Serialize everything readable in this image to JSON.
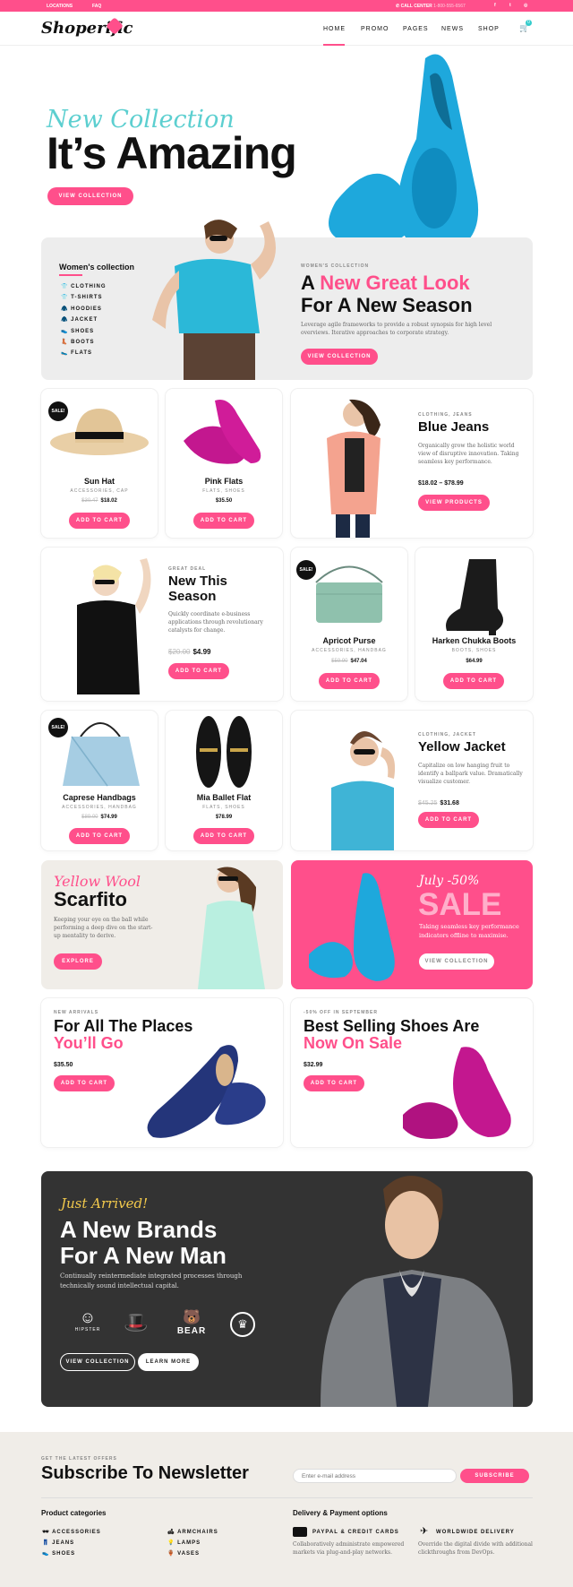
{
  "topbar": {
    "locations": "LOCATIONS",
    "faq": "FAQ",
    "call_center": "CALL CENTER",
    "phone": "1-800-555-6567"
  },
  "header": {
    "logo": "Shoperific",
    "nav": [
      "HOME",
      "PROMO",
      "PAGES",
      "NEWS",
      "SHOP"
    ],
    "cart_count": "0"
  },
  "hero": {
    "script": "New Collection",
    "title": "It’s Amazing",
    "button": "VIEW COLLECTION"
  },
  "women": {
    "heading": "Women's collection",
    "items": [
      "CLOTHING",
      "T-SHIRTS",
      "HOODIES",
      "JACKET",
      "SHOES",
      "BOOTS",
      "FLATS"
    ],
    "tag": "WOMEN'S COLLECTION",
    "title_a": "A ",
    "title_pink": "New Great Look",
    "title_b": "For A New Season",
    "text": "Leverage agile frameworks to provide a robust synopsis for high level overviews. Iterative approaches to corporate strategy.",
    "button": "VIEW COLLECTION"
  },
  "p_sunhat": {
    "sale": "SALE!",
    "name": "Sun Hat",
    "cat": "ACCESSORIES, CAP",
    "old": "$30.47",
    "price": "$18.02",
    "button": "ADD TO CART"
  },
  "p_pinkflats": {
    "name": "Pink Flats",
    "cat": "FLATS, SHOES",
    "price": "$35.50",
    "button": "ADD TO CART"
  },
  "jeans": {
    "tag": "CLOTHING, JEANS",
    "title": "Blue Jeans",
    "text": "Organically grow the holistic world view of disruptive innovation. Taking seamless key performance.",
    "price": "$18.02 – $78.99",
    "button": "VIEW PRODUCTS"
  },
  "season": {
    "tag": "GREAT DEAL",
    "title_1": "New This",
    "title_2": "Season",
    "text": "Quickly coordinate e-business applications through revolutionary catalysts for change.",
    "old": "$20.00",
    "price": "$4.99",
    "button": "ADD TO CART"
  },
  "p_purse": {
    "sale": "SALE!",
    "name": "Apricot Purse",
    "cat": "ACCESSORIES, HANDBAG",
    "old": "$59.90",
    "price": "$47.04",
    "button": "ADD TO CART"
  },
  "p_boots": {
    "name": "Harken Chukka Boots",
    "cat": "BOOTS, SHOES",
    "price": "$64.99",
    "button": "ADD TO CART"
  },
  "p_caprese": {
    "sale": "SALE!",
    "name": "Caprese Handbags",
    "cat": "ACCESSORIES, HANDBAG",
    "old": "$89.00",
    "price": "$74.99",
    "button": "ADD TO CART"
  },
  "p_ballet": {
    "name": "Mia Ballet Flat",
    "cat": "FLATS, SHOES",
    "price": "$78.99",
    "button": "ADD TO CART"
  },
  "jacket": {
    "tag": "CLOTHING, JACKET",
    "title": "Yellow Jacket",
    "text": "Capitalize on low hanging fruit to identify a ballpark value. Dramatically visualize customer.",
    "old": "$45.25",
    "price": "$31.68",
    "button": "ADD TO CART"
  },
  "scarf": {
    "script": "Yellow Wool",
    "title": "Scarfito",
    "text": "Keeping your eye on the ball while performing a deep dive on the start-up mentality to derive.",
    "button": "EXPLORE"
  },
  "sale": {
    "script": "July -50%",
    "title": "SALE",
    "text": "Taking seamless key performance indicators offline to maximise.",
    "button": "VIEW COLLECTION"
  },
  "places": {
    "tag": "NEW ARRIVALS",
    "title_1": "For All The Places",
    "title_2": "You’ll Go",
    "price": "$35.50",
    "button": "ADD TO CART"
  },
  "best": {
    "tag": "-50% OFF IN SEPTEMBER",
    "title_1": "Best Selling Shoes Are",
    "title_2": "Now On Sale",
    "price": "$32.99",
    "button": "ADD TO CART"
  },
  "man": {
    "script": "Just Arrived!",
    "title_1": "A New Brands",
    "title_2": "For A New Man",
    "text": "Continually reintermediate integrated processes through technically sound intellectual capital.",
    "logos": [
      "HIPSTER",
      "BEAR"
    ],
    "btn1": "VIEW COLLECTION",
    "btn2": "LEARN MORE"
  },
  "newsletter": {
    "tag": "GET THE LATEST OFFERS",
    "title": "Subscribe To Newsletter",
    "placeholder": "Enter e-mail address",
    "button": "SUBSCRIBE"
  },
  "footer": {
    "cat_title": "Product categories",
    "cats_col1": [
      "ACCESSORIES",
      "JEANS",
      "SHOES"
    ],
    "cats_col2": [
      "ARMCHAIRS",
      "LAMPS",
      "VASES"
    ],
    "delivery_title": "Delivery & Payment options",
    "pay_title": "PAYPAL & CREDIT CARDS",
    "pay_text": "Collaboratively administrate empowered markets via plug-and-play networks.",
    "ship_title": "WORLDWIDE DELIVERY",
    "ship_text": "Override the digital divide with additional clickthroughs from DevOps."
  },
  "colors": {
    "accent": "#ff4f8b",
    "dark": "#333333",
    "cream": "#f0ede8",
    "shoe_blue": "#1ea8dc",
    "shoe_magenta": "#c3178f"
  }
}
